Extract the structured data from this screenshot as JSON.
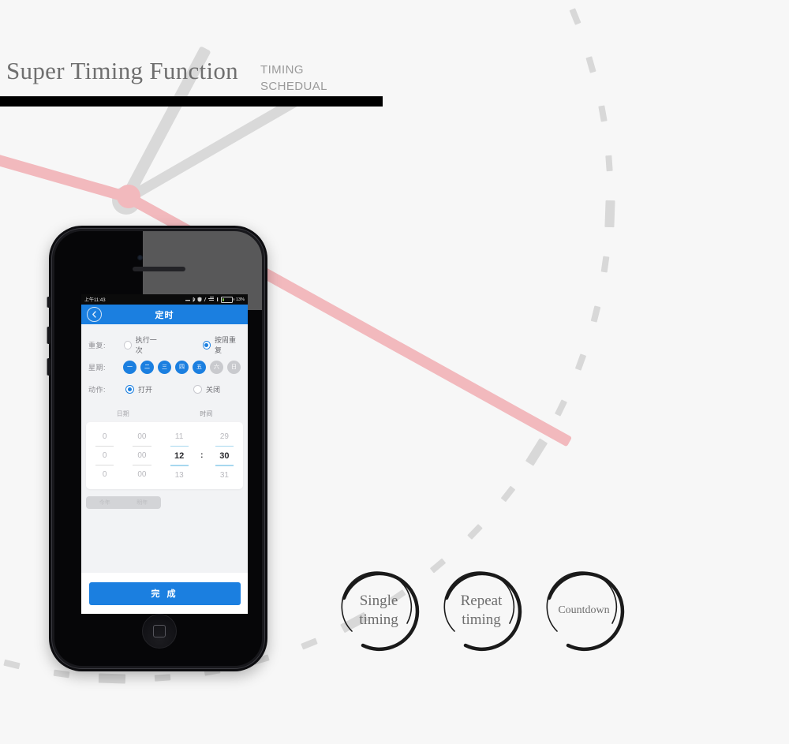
{
  "header": {
    "title": "Super Timing Function",
    "sub_line1": "TIMING",
    "sub_line2": "SCHEDUAL"
  },
  "phone": {
    "statusbar": {
      "time": "上午11:43",
      "battery_percent": "13%",
      "icons": [
        "signal-icon",
        "bluetooth-icon",
        "shield-icon",
        "sync-icon",
        "wifi-icon",
        "vibrate-icon",
        "battery-icon"
      ]
    },
    "navbar": {
      "back_icon": "chevron-left-icon",
      "title": "定时"
    },
    "form": {
      "repeat": {
        "label": "重复:",
        "option_once": "执行一次",
        "option_weekly": "按周重复",
        "selected": "按周重复"
      },
      "week": {
        "label": "星期:",
        "days": [
          {
            "text": "一",
            "on": true
          },
          {
            "text": "二",
            "on": true
          },
          {
            "text": "三",
            "on": true
          },
          {
            "text": "四",
            "on": true
          },
          {
            "text": "五",
            "on": true
          },
          {
            "text": "六",
            "on": false
          },
          {
            "text": "日",
            "on": false
          }
        ]
      },
      "action": {
        "label": "动作:",
        "option_on": "打开",
        "option_off": "关闭",
        "selected": "打开"
      }
    },
    "picker": {
      "head_date": "日期",
      "head_time": "时间",
      "date_col1": {
        "prev": "0",
        "current": "0",
        "next": "0"
      },
      "date_col2": {
        "prev": "00",
        "current": "00",
        "next": "00"
      },
      "hour": {
        "prev": "11",
        "current": "12",
        "next": "13"
      },
      "minute": {
        "prev": "29",
        "current": "30",
        "next": "31"
      },
      "colon": ":"
    },
    "segment": {
      "this_year": "今年",
      "next_year": "明年"
    },
    "done_button": "完 成"
  },
  "circles": [
    {
      "line1": "Single",
      "line2": "timing",
      "small": false
    },
    {
      "line1": "Repeat",
      "line2": "timing",
      "small": false
    },
    {
      "line1": "Countdown",
      "line2": "",
      "small": true
    }
  ],
  "colors": {
    "brand_blue": "#1b7fe0",
    "page_bg": "#f7f7f7",
    "rule_black": "#000000",
    "hand_pink": "#f2b9bd",
    "hand_gray": "#d9d9d9",
    "tick_gray": "#d8d8d8"
  }
}
